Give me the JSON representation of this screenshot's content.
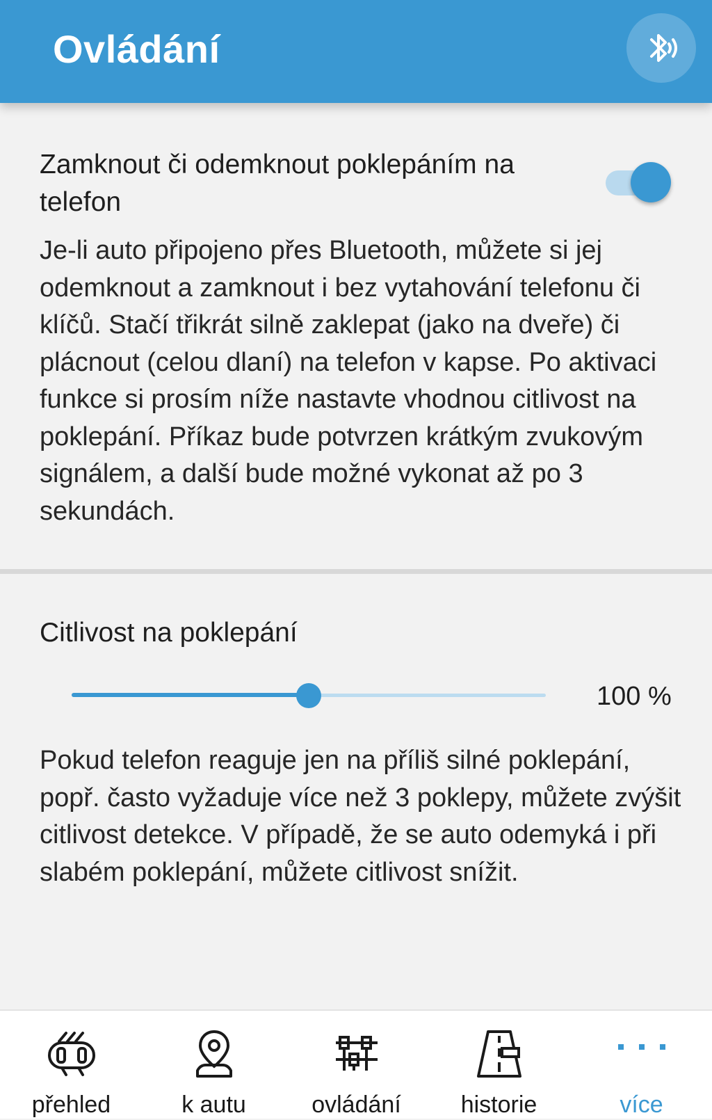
{
  "app_bar": {
    "title": "Ovládání",
    "bluetooth_icon": "bluetooth-audio-icon",
    "color": "#3a98d2"
  },
  "knock_setting": {
    "title": "Zamknout či odemknout poklepáním na telefon",
    "enabled": true,
    "description": "Je-li auto připojeno přes Bluetooth, můžete si jej odemknout a zamknout i bez vytahování telefonu či klíčů. Stačí třikrát silně zaklepat (jako na dveře) či plácnout (celou dlaní) na telefon v kapse. Po aktivaci funkce si prosím níže nastavte vhodnou citlivost na poklepání. Příkaz bude potvrzen krátkým zvukovým signálem, a další bude možné vykonat až po 3 sekundách."
  },
  "sensitivity": {
    "label": "Citlivost na poklepání",
    "value_text": "100 %",
    "position_fraction": 0.5,
    "description": "Pokud telefon reaguje jen na příliš silné poklepání, popř. často vyžaduje více než 3 poklepy, můžete zvýšit citlivost detekce. V případě, že se auto odemyká i při slabém poklepání, můžete citlivost snížit."
  },
  "bottom_nav": {
    "active_color": "#3a98d2",
    "items": [
      {
        "label": "přehled",
        "icon": "car-overview-icon",
        "active": false
      },
      {
        "label": "k autu",
        "icon": "map-pin-car-icon",
        "active": false
      },
      {
        "label": "ovládání",
        "icon": "controls-icon",
        "active": false
      },
      {
        "label": "historie",
        "icon": "road-history-icon",
        "active": false
      },
      {
        "label": "více",
        "icon": "more-dots-icon",
        "active": true
      }
    ]
  }
}
